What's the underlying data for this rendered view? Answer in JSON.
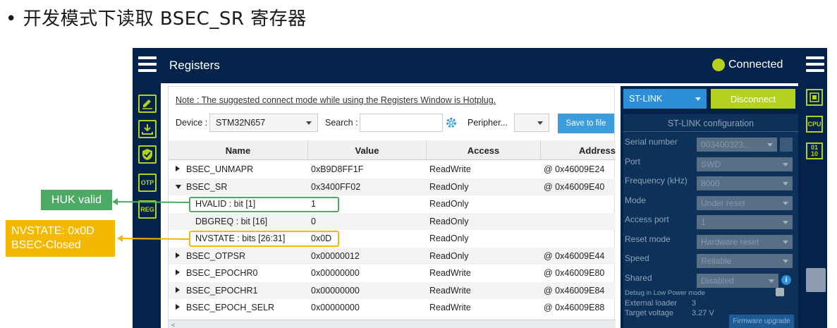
{
  "slide": {
    "bullet": "•",
    "title": "开发模式下读取 BSEC_SR 寄存器"
  },
  "app": {
    "title": "Registers",
    "status": "Connected",
    "left_tools": [
      "OTP",
      "REG"
    ],
    "note": "Note : The suggested connect mode while using the Registers Window is Hotplug.",
    "device_label": "Device :",
    "device_value": "STM32N657",
    "search_label": "Search :",
    "search_value": "",
    "peripheral_label": "Peripher...",
    "save_label": "Save to file",
    "columns": [
      "Name",
      "Value",
      "Access",
      "Address"
    ],
    "rows": [
      {
        "name": "BSEC_UNMAPR",
        "value": "0xB9D8FF1F",
        "access": "ReadWrite",
        "address": "@ 0x46009E24",
        "level": 0,
        "expander": "right"
      },
      {
        "name": "BSEC_SR",
        "value": "0x3400FF02",
        "access": "ReadOnly",
        "address": "@ 0x46009E40",
        "level": 0,
        "expander": "down"
      },
      {
        "name": "HVALID : bit [1]",
        "value": "1",
        "access": "ReadOnly",
        "address": "",
        "level": 1,
        "expander": "none"
      },
      {
        "name": "DBGREQ : bit [16]",
        "value": "0",
        "access": "ReadOnly",
        "address": "",
        "level": 1,
        "expander": "none"
      },
      {
        "name": "NVSTATE : bits [26:31]",
        "value": "0x0D",
        "access": "ReadOnly",
        "address": "",
        "level": 1,
        "expander": "none"
      },
      {
        "name": "BSEC_OTPSR",
        "value": "0x00000012",
        "access": "ReadOnly",
        "address": "@ 0x46009E44",
        "level": 0,
        "expander": "right"
      },
      {
        "name": "BSEC_EPOCHR0",
        "value": "0x00000000",
        "access": "ReadWrite",
        "address": "@ 0x46009E80",
        "level": 0,
        "expander": "right"
      },
      {
        "name": "BSEC_EPOCHR1",
        "value": "0x00000000",
        "access": "ReadWrite",
        "address": "@ 0x46009E84",
        "level": 0,
        "expander": "right"
      },
      {
        "name": "BSEC_EPOCH_SELR",
        "value": "0x00000000",
        "access": "ReadWrite",
        "address": "@ 0x46009E88",
        "level": 0,
        "expander": "right"
      }
    ],
    "probe": "ST-LINK",
    "disconnect_label": "Disconnect",
    "config_title": "ST-LINK configuration",
    "fields": [
      {
        "label": "Serial number",
        "value": "003400323..."
      },
      {
        "label": "Port",
        "value": "SWD"
      },
      {
        "label": "Frequency (kHz)",
        "value": "8000"
      },
      {
        "label": "Mode",
        "value": "Under reset"
      },
      {
        "label": "Access port",
        "value": "1"
      },
      {
        "label": "Reset mode",
        "value": "Hardware reset"
      },
      {
        "label": "Speed",
        "value": "Reliable"
      },
      {
        "label": "Shared",
        "value": "Disabled"
      }
    ],
    "debug_low_power": "Debug in Low Power mode",
    "external_loader_label": "External loader",
    "external_loader_value": "3",
    "target_voltage_label": "Target voltage",
    "target_voltage_value": "3.27 V",
    "firmware_label": "Firmware upgrade",
    "right_tools": [
      "CPU",
      "01\n10"
    ]
  },
  "annotations": {
    "huk": "HUK valid",
    "nvstate_line1": "NVSTATE:  0x0D",
    "nvstate_line2": "BSEC-Closed"
  },
  "colors": {
    "navy": "#03234b",
    "lime": "#b5d120",
    "blue": "#3c9ddc",
    "green_annot": "#4caa64",
    "yellow_annot": "#f4b800"
  }
}
